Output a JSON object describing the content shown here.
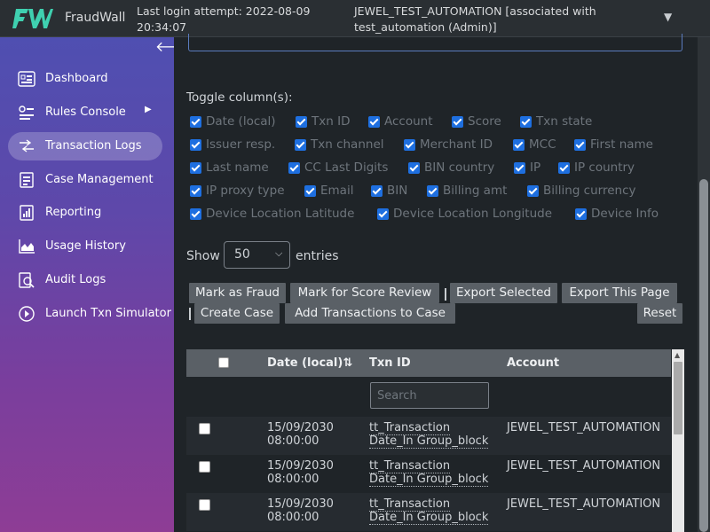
{
  "header": {
    "brand": "FraudWall",
    "login_line1": "Last login attempt: 2022-08-09",
    "login_line2": "20:34:07",
    "account_line1": "JEWEL_TEST_AUTOMATION [associated with",
    "account_line2": "test_automation (Admin)]",
    "account_caret_icon": "caret-down-icon",
    "logo_color": "#3fd0b0"
  },
  "sidebar": {
    "collapse_icon": "arrow-left-icon",
    "items": [
      {
        "label": "Dashboard",
        "icon": "dashboard-icon"
      },
      {
        "label": "Rules Console",
        "icon": "rules-icon"
      },
      {
        "label": "Transaction Logs",
        "icon": "transaction-logs-icon"
      },
      {
        "label": "Case Management",
        "icon": "case-icon"
      },
      {
        "label": "Reporting",
        "icon": "report-icon"
      },
      {
        "label": "Usage History",
        "icon": "usage-chart-icon"
      },
      {
        "label": "Audit Logs",
        "icon": "audit-search-icon"
      },
      {
        "label": "Launch Txn Simulator",
        "icon": "play-icon"
      }
    ]
  },
  "toggles": {
    "title": "Toggle column(s):",
    "items": [
      "Date (local)",
      "Txn ID",
      "Account",
      "Score",
      "Txn state",
      "Issuer resp.",
      "Txn channel",
      "Merchant ID",
      "MCC",
      "First name",
      "Last name",
      "CC Last Digits",
      "BIN country",
      "IP",
      "IP country",
      "IP proxy type",
      "Email",
      "BIN",
      "Billing amt",
      "Billing currency",
      "Device Location Latitude",
      "Device Location Longitude",
      "Device Info"
    ]
  },
  "entries": {
    "show": "Show",
    "value": "50",
    "suffix": "entries"
  },
  "actions": {
    "mark_fraud": "Mark as Fraud",
    "mark_review": "Mark for Score Review",
    "export_selected": "Export Selected",
    "export_page": "Export This Page",
    "create_case": "Create Case",
    "add_to_case": "Add Transactions to Case",
    "reset": "Reset"
  },
  "table": {
    "headers": {
      "date": "Date (local)",
      "sort_icon": "⇅",
      "txn": "Txn ID",
      "account": "Account"
    },
    "search_placeholder": "Search",
    "rows": [
      {
        "date1": "15/09/2030",
        "date2": "08:00:00",
        "txn1": "tt_Transaction",
        "txn2": "Date_In Group_block",
        "account": "JEWEL_TEST_AUTOMATION"
      },
      {
        "date1": "15/09/2030",
        "date2": "08:00:00",
        "txn1": "tt_Transaction",
        "txn2": "Date_In Group_block",
        "account": "JEWEL_TEST_AUTOMATION"
      },
      {
        "date1": "15/09/2030",
        "date2": "08:00:00",
        "txn1": "tt_Transaction",
        "txn2": "Date_In Group_block",
        "account": "JEWEL_TEST_AUTOMATION"
      }
    ]
  }
}
